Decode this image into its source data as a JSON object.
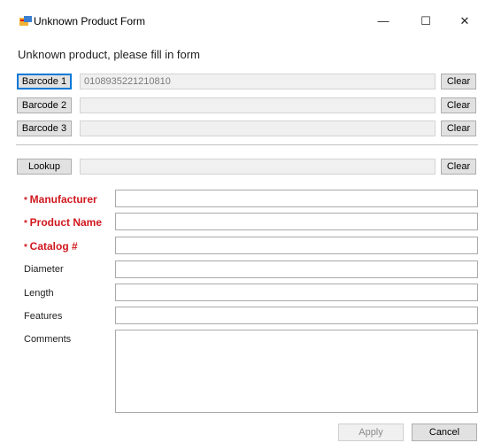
{
  "window": {
    "title": "Unknown Product Form",
    "controls": {
      "minimize": "—",
      "maximize": "☐",
      "close": "✕"
    }
  },
  "heading": "Unknown product, please fill in form",
  "barcodes": [
    {
      "label": "Barcode 1",
      "value": "0108935221210810",
      "clear": "Clear"
    },
    {
      "label": "Barcode 2",
      "value": "",
      "clear": "Clear"
    },
    {
      "label": "Barcode 3",
      "value": "",
      "clear": "Clear"
    }
  ],
  "lookup": {
    "label": "Lookup",
    "value": "",
    "clear": "Clear"
  },
  "fields": {
    "manufacturer": {
      "label": "Manufacturer",
      "required": true,
      "value": ""
    },
    "product_name": {
      "label": "Product Name",
      "required": true,
      "value": ""
    },
    "catalog": {
      "label": "Catalog #",
      "required": true,
      "value": ""
    },
    "diameter": {
      "label": "Diameter",
      "value": ""
    },
    "length": {
      "label": "Length",
      "value": ""
    },
    "features": {
      "label": "Features",
      "value": ""
    },
    "comments": {
      "label": "Comments",
      "value": ""
    }
  },
  "actions": {
    "apply": "Apply",
    "cancel": "Cancel"
  },
  "icons": {
    "app": "form-app-icon"
  },
  "colors": {
    "required": "#d0181f",
    "focus": "#0078d7"
  }
}
